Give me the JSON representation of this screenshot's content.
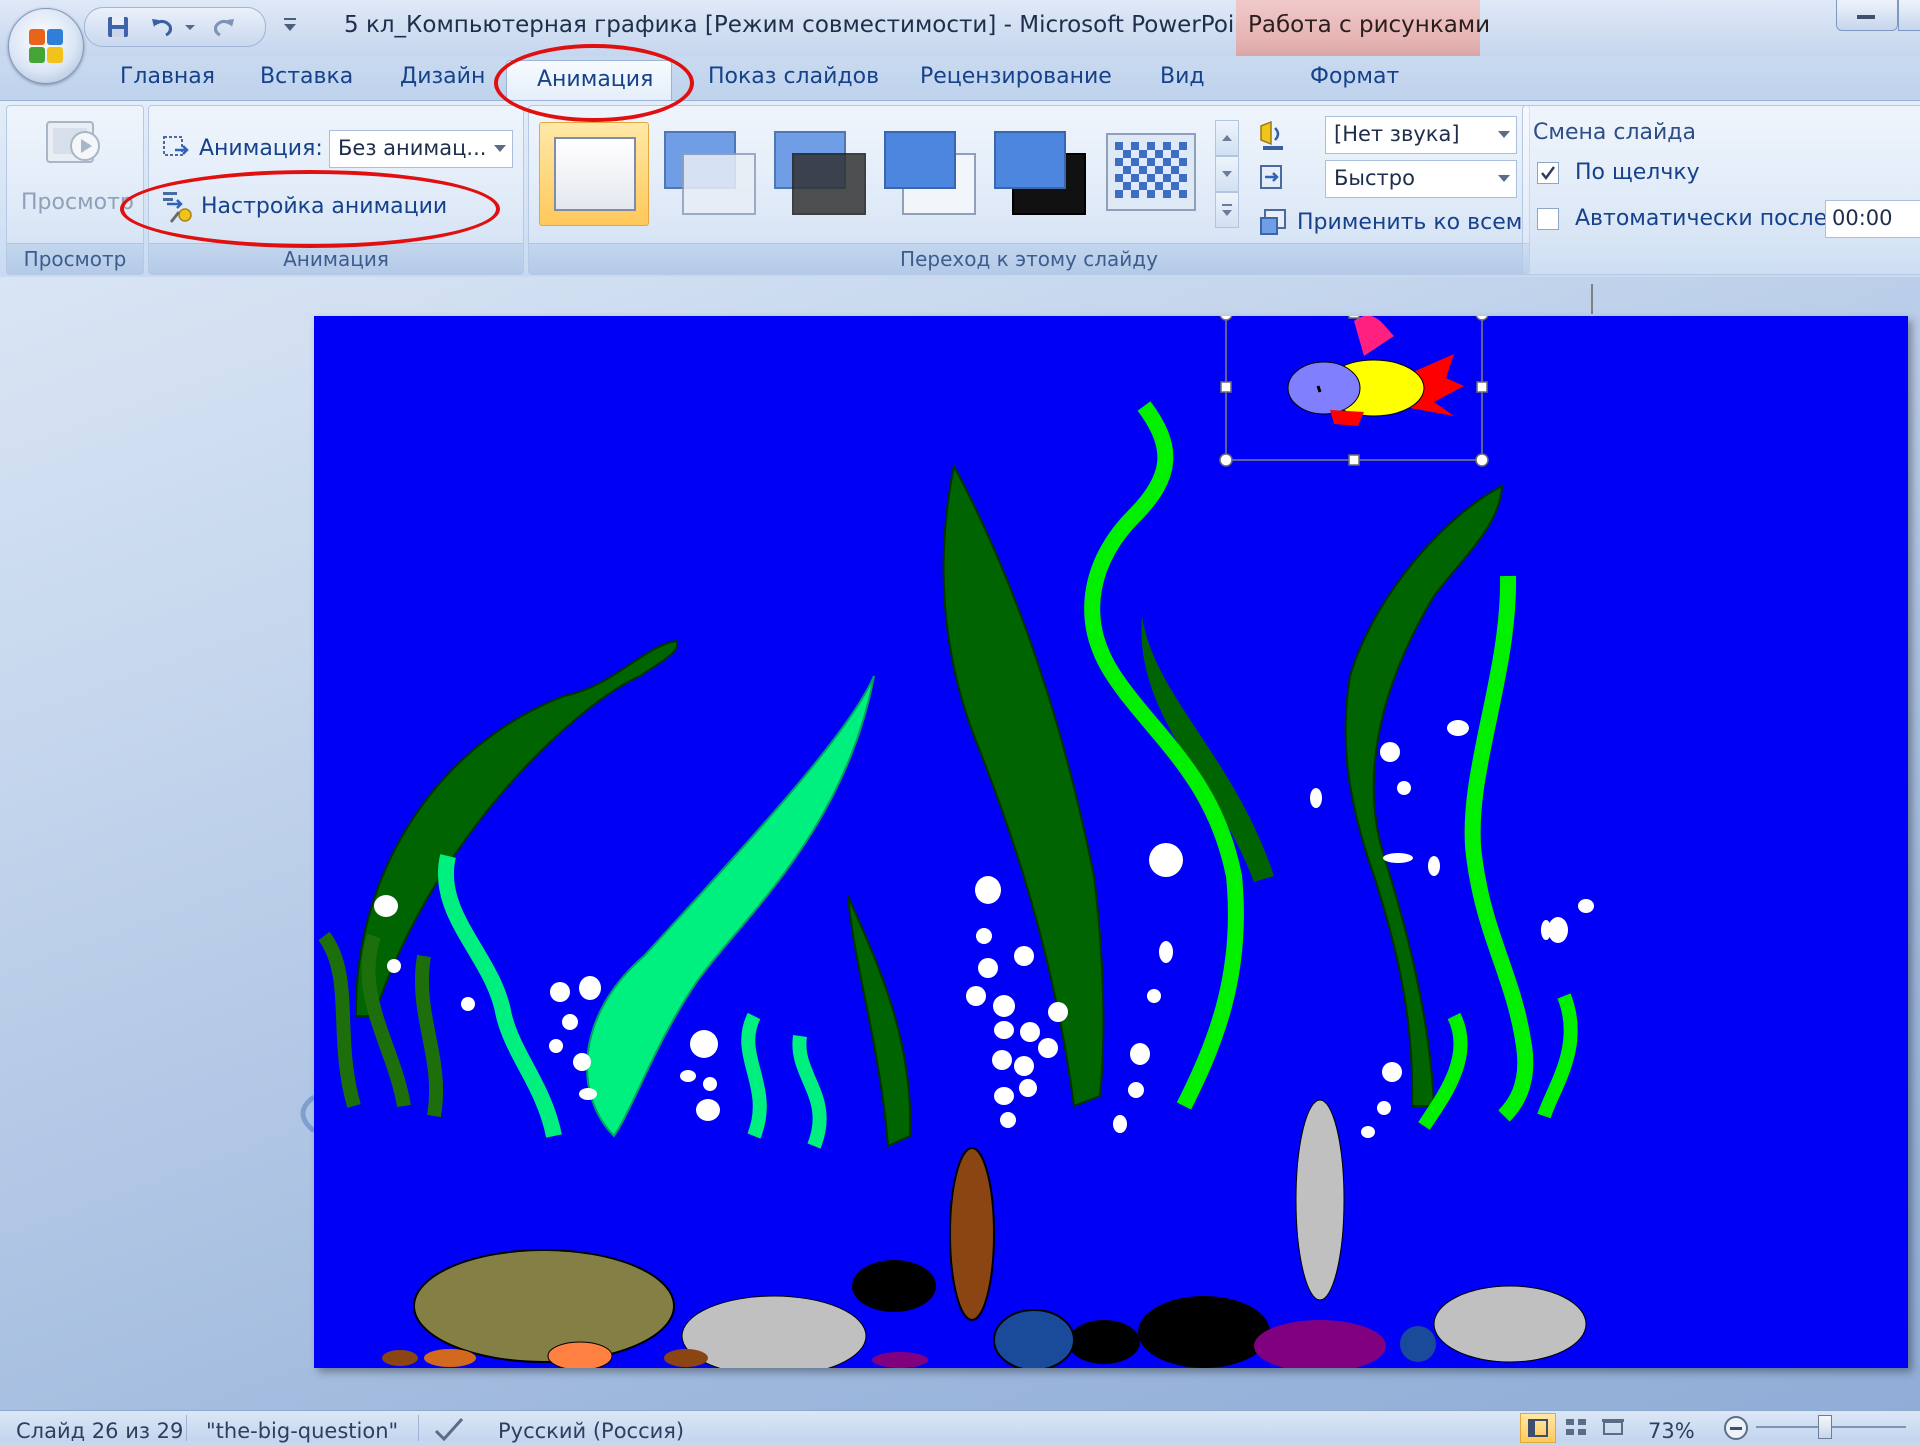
{
  "window": {
    "title": "5 кл_Компьютерная графика [Режим совместимости] - Microsoft PowerPoint",
    "context_tab_group": "Работа с рисунками"
  },
  "tabs": [
    "Главная",
    "Вставка",
    "Дизайн",
    "Анимация",
    "Показ слайдов",
    "Рецензирование",
    "Вид",
    "Формат"
  ],
  "active_tab": "Анимация",
  "ribbon": {
    "preview_group": {
      "button_label": "Просмотр",
      "caption": "Просмотр"
    },
    "animation_group": {
      "animation_label": "Анимация:",
      "animation_value": "Без анимац...",
      "custom_animation_label": "Настройка анимации",
      "caption": "Анимация"
    },
    "transition_group": {
      "caption": "Переход к этому слайду",
      "sound_value": "[Нет звука]",
      "speed_value": "Быстро",
      "apply_all_label": "Применить ко всем"
    },
    "advance_group": {
      "title": "Смена слайда",
      "on_click_label": "По щелчку",
      "on_click_checked": true,
      "auto_after_label": "Автоматически после:",
      "auto_after_checked": false,
      "auto_after_value": "00:00"
    }
  },
  "status": {
    "slide_info": "Слайд 26 из 29",
    "theme": "\"the-big-question\"",
    "language": "Русский (Россия)",
    "zoom": "73%"
  },
  "colors": {
    "slide_background": "#0000f7",
    "annotation_ring": "#e01010",
    "ribbon_text": "#15428b",
    "context_tab": "#e6b4b4"
  }
}
